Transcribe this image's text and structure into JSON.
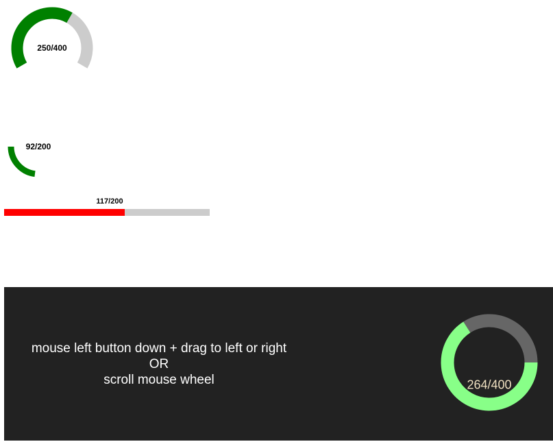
{
  "gauges": {
    "gauge1": {
      "label": "250/400",
      "value": 250,
      "max": 400,
      "fill_color": "#008000",
      "track_color": "#cccccc"
    },
    "gauge2": {
      "label": "92/200",
      "value": 92,
      "max": 200,
      "fill_color": "#008000"
    },
    "linear": {
      "label": "117/200",
      "value": 117,
      "max": 200,
      "fill_color": "#ff0000",
      "track_color": "#cccccc"
    },
    "interactive": {
      "label": "264/400",
      "value": 264,
      "max": 400,
      "fill_color": "#88ff88",
      "track_color": "#666666",
      "label_color": "#eedfc0"
    }
  },
  "panel": {
    "background": "#222222",
    "instructions": {
      "line1": "mouse left button down + drag to left or right",
      "line2": "OR",
      "line3": "scroll mouse wheel"
    }
  }
}
